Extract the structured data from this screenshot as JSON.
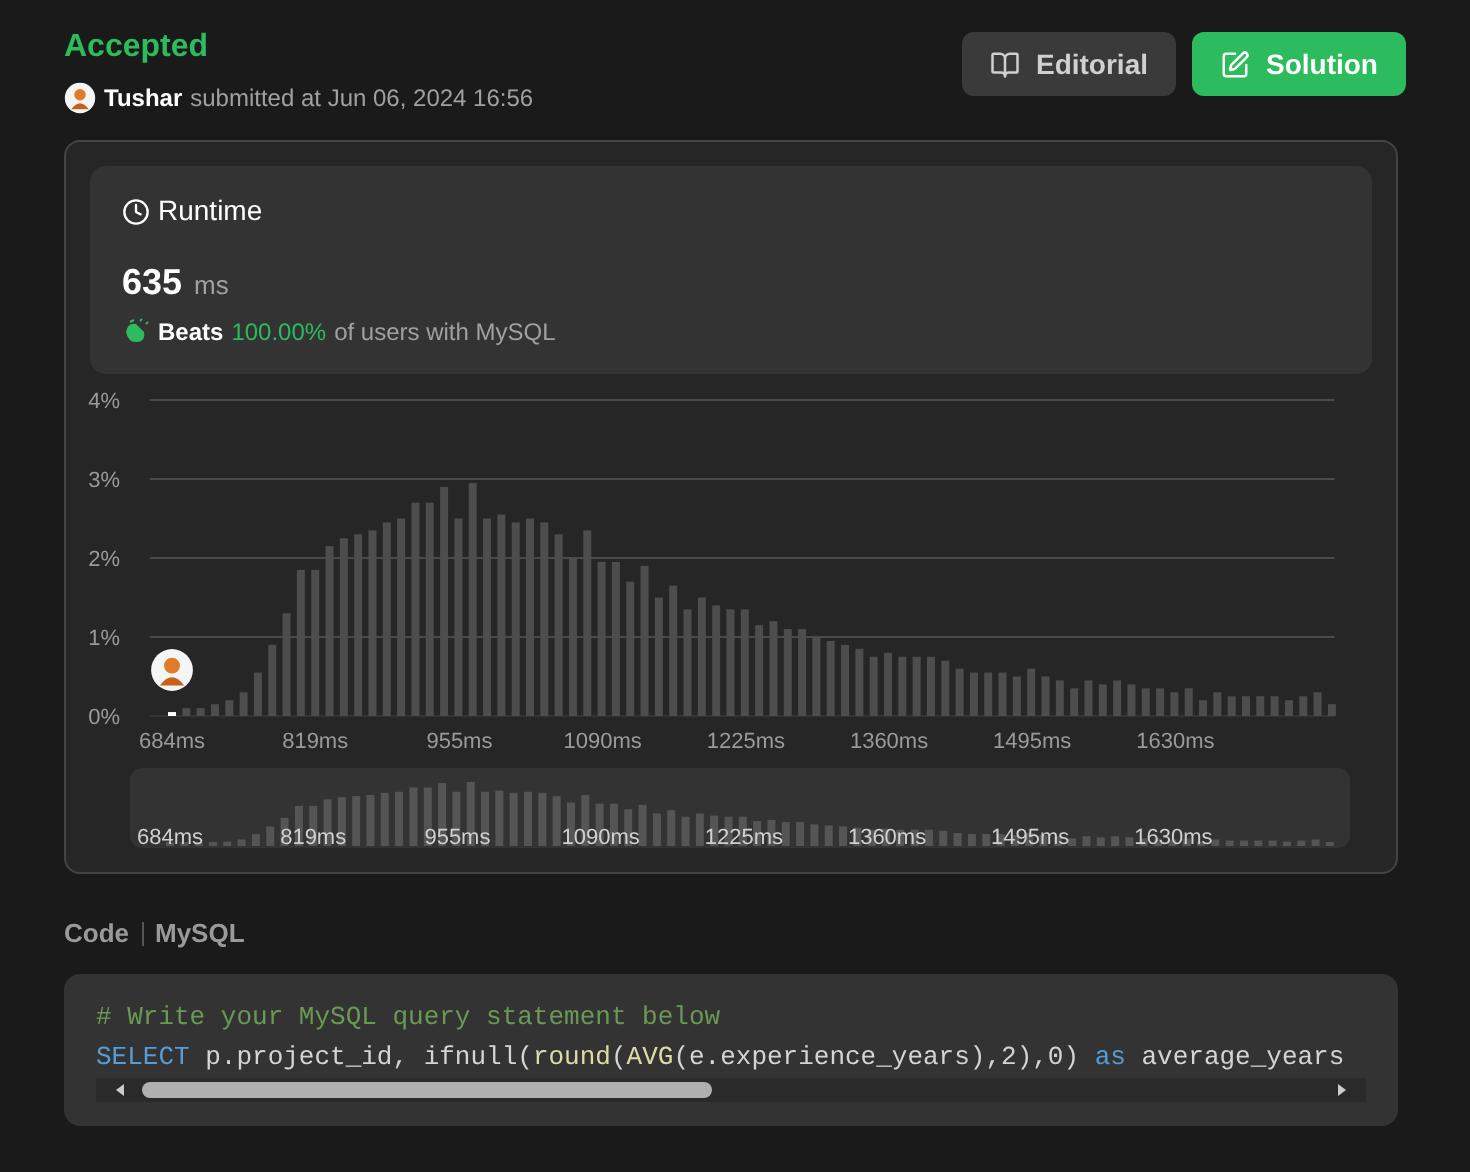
{
  "header": {
    "status": "Accepted",
    "user": "Tushar",
    "submitted": "submitted at Jun 06, 2024 16:56"
  },
  "buttons": [
    {
      "label": "Editorial",
      "kind": "secondary"
    },
    {
      "label": "Solution",
      "kind": "primary"
    }
  ],
  "runtime": {
    "title": "Runtime",
    "value": "635",
    "unit": "ms",
    "beats_label": "Beats",
    "beats_value": "100.00%",
    "beats_suffix": "of users with MySQL"
  },
  "chart_data": {
    "type": "bar",
    "grid": true,
    "xlim": [
      663,
      1780
    ],
    "ylim": [
      0,
      4
    ],
    "yticks": [
      {
        "value": 0,
        "label": "0%"
      },
      {
        "value": 1,
        "label": "1%"
      },
      {
        "value": 2,
        "label": "2%"
      },
      {
        "value": 3,
        "label": "3%"
      },
      {
        "value": 4,
        "label": "4%"
      }
    ],
    "xticks": [
      {
        "value": 684,
        "label": "684ms"
      },
      {
        "value": 819,
        "label": "819ms"
      },
      {
        "value": 955,
        "label": "955ms"
      },
      {
        "value": 1090,
        "label": "1090ms"
      },
      {
        "value": 1225,
        "label": "1225ms"
      },
      {
        "value": 1360,
        "label": "1360ms"
      },
      {
        "value": 1495,
        "label": "1495ms"
      },
      {
        "value": 1630,
        "label": "1630ms"
      }
    ],
    "x": [
      684,
      697.5,
      711,
      724.5,
      738,
      751.5,
      765,
      778.5,
      792,
      805.5,
      819,
      832.5,
      846,
      859.5,
      873,
      886.5,
      900,
      913.5,
      927,
      940.5,
      954,
      967.5,
      981,
      994.5,
      1008,
      1021.5,
      1035,
      1048.5,
      1062,
      1075.5,
      1089,
      1102.5,
      1116,
      1129.5,
      1143,
      1156.5,
      1170,
      1183.5,
      1197,
      1210.5,
      1224,
      1237.5,
      1251,
      1264.5,
      1278,
      1291.5,
      1305,
      1318.5,
      1332,
      1345.5,
      1359,
      1372.5,
      1386,
      1399.5,
      1413,
      1426.5,
      1440,
      1453.5,
      1467,
      1480.5,
      1494,
      1507.5,
      1521,
      1534.5,
      1548,
      1561.5,
      1575,
      1588.5,
      1602,
      1615.5,
      1629,
      1642.5,
      1656,
      1669.5,
      1683,
      1696.5,
      1710,
      1723.5,
      1737,
      1750.5,
      1764,
      1777.5
    ],
    "series": [
      {
        "color": "#4d4d4d",
        "values": [
          null,
          0.1,
          0.1,
          0.15,
          0.2,
          0.3,
          0.55,
          0.9,
          1.3,
          1.85,
          1.85,
          2.15,
          2.25,
          2.3,
          2.35,
          2.45,
          2.5,
          2.7,
          2.7,
          2.9,
          2.5,
          2.95,
          2.5,
          2.55,
          2.45,
          2.5,
          2.45,
          2.3,
          2.0,
          2.35,
          1.95,
          1.95,
          1.7,
          1.9,
          1.5,
          1.65,
          1.35,
          1.5,
          1.4,
          1.35,
          1.35,
          1.15,
          1.2,
          1.1,
          1.1,
          1.0,
          0.95,
          0.9,
          0.85,
          0.75,
          0.8,
          0.75,
          0.75,
          0.75,
          0.7,
          0.6,
          0.55,
          0.55,
          0.55,
          0.5,
          0.6,
          0.5,
          0.45,
          0.35,
          0.45,
          0.4,
          0.45,
          0.4,
          0.35,
          0.35,
          0.3,
          0.35,
          0.2,
          0.3,
          0.25,
          0.25,
          0.25,
          0.25,
          0.2,
          0.25,
          0.3,
          0.15
        ]
      },
      {
        "color": "#ffffff",
        "values": [
          0.05,
          null,
          null,
          null,
          null,
          null,
          null,
          null,
          null,
          null,
          null,
          null,
          null,
          null,
          null,
          null,
          null,
          null,
          null,
          null,
          null,
          null,
          null,
          null,
          null,
          null,
          null,
          null,
          null,
          null,
          null,
          null,
          null,
          null,
          null,
          null,
          null,
          null,
          null,
          null,
          null,
          null,
          null,
          null,
          null,
          null,
          null,
          null,
          null,
          null,
          null,
          null,
          null,
          null,
          null,
          null,
          null,
          null,
          null,
          null,
          null,
          null,
          null,
          null,
          null,
          null,
          null,
          null,
          null,
          null,
          null,
          null,
          null,
          null,
          null,
          null,
          null,
          null,
          null,
          null,
          null,
          null
        ]
      }
    ]
  },
  "navigator": {
    "labels": [
      "684ms",
      "819ms",
      "955ms",
      "1090ms",
      "1225ms",
      "1360ms",
      "1495ms",
      "1630ms"
    ]
  },
  "code": {
    "label": "Code",
    "language": "MySQL",
    "lines": [
      [
        {
          "text": "# Write your MySQL query statement below",
          "kind": "comment"
        }
      ],
      [
        {
          "text": "SELECT",
          "kind": "keyword"
        },
        {
          "text": " p.project_id, ifnull(",
          "kind": "plain"
        },
        {
          "text": "round",
          "kind": "function"
        },
        {
          "text": "(",
          "kind": "plain"
        },
        {
          "text": "AVG",
          "kind": "function"
        },
        {
          "text": "(e.experience_years),2),0) ",
          "kind": "plain"
        },
        {
          "text": "as",
          "kind": "keyword"
        },
        {
          "text": " average_years",
          "kind": "plain"
        }
      ]
    ]
  }
}
